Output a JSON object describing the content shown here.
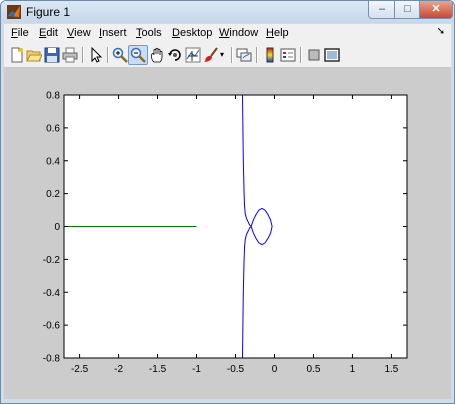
{
  "window": {
    "title": "Figure 1"
  },
  "captions": {
    "minimize": "–",
    "maximize": "□",
    "close": "✕"
  },
  "menu": [
    {
      "label": "File",
      "u": "F",
      "rest": "ile"
    },
    {
      "label": "Edit",
      "u": "E",
      "rest": "dit"
    },
    {
      "label": "View",
      "u": "V",
      "rest": "iew"
    },
    {
      "label": "Insert",
      "u": "I",
      "rest": "nsert"
    },
    {
      "label": "Tools",
      "u": "T",
      "rest": "ools"
    },
    {
      "label": "Desktop",
      "u": "D",
      "rest": "esktop"
    },
    {
      "label": "Window",
      "u": "W",
      "rest": "indow"
    },
    {
      "label": "Help",
      "u": "H",
      "rest": "elp"
    }
  ],
  "menu_extra_icon": "dock-arrow-icon",
  "toolbar": [
    "new-figure-icon",
    "open-file-icon",
    "save-icon",
    "print-icon",
    "edit-plot-icon",
    "zoom-in-icon",
    "zoom-out-icon",
    "pan-icon",
    "rotate-3d-icon",
    "data-cursor-icon",
    "brush-icon",
    "brush-dropdown-icon",
    "link-plot-icon",
    "insert-colorbar-icon",
    "insert-legend-icon",
    "hide-plot-tools-icon",
    "show-plot-tools-icon"
  ],
  "toolbar_active": "zoom-out-icon",
  "chart_data": {
    "type": "line",
    "title": "",
    "xlabel": "",
    "ylabel": "",
    "xlim": [
      -2.7,
      1.7
    ],
    "ylim": [
      -0.8,
      0.8
    ],
    "xticks": [
      -2.5,
      -2,
      -1.5,
      -1,
      -0.5,
      0,
      0.5,
      1,
      1.5
    ],
    "xtick_labels": [
      "-2.5",
      "-2",
      "-1.5",
      "-1",
      "-0.5",
      "0",
      "0.5",
      "1",
      "1.5"
    ],
    "yticks": [
      0.8,
      0.6,
      0.4,
      0.2,
      0,
      -0.2,
      -0.4,
      -0.6,
      -0.8
    ],
    "ytick_labels": [
      "0.8",
      "0.6",
      "0.4",
      "0.2",
      "0",
      "-0.2",
      "-0.4",
      "-0.6",
      "-0.8"
    ],
    "grid": false,
    "series": [
      {
        "color": "#008000",
        "x": [
          -2.7,
          -1.0
        ],
        "y": [
          0,
          0
        ]
      },
      {
        "color": "#0000ff",
        "x": [
          -0.41,
          -0.405,
          -0.4,
          -0.395,
          -0.39,
          -0.385,
          -0.375,
          -0.36,
          -0.34,
          -0.33,
          -0.32,
          -0.31,
          -0.3,
          -0.31,
          -0.32,
          -0.33,
          -0.34,
          -0.36,
          -0.375,
          -0.385,
          -0.39,
          -0.395,
          -0.4,
          -0.405,
          -0.41
        ],
        "y": [
          0.8,
          0.6,
          0.4,
          0.3,
          0.2,
          0.13,
          0.08,
          0.05,
          0.03,
          0.02,
          0.01,
          0.005,
          0,
          -0.005,
          -0.01,
          -0.02,
          -0.03,
          -0.05,
          -0.08,
          -0.13,
          -0.2,
          -0.3,
          -0.4,
          -0.6,
          -0.8
        ]
      },
      {
        "color": "#0000ff",
        "x": [
          -0.3,
          -0.27,
          -0.24,
          -0.2,
          -0.16,
          -0.12,
          -0.08,
          -0.05,
          -0.03,
          -0.05,
          -0.08,
          -0.12,
          -0.16,
          -0.2,
          -0.24,
          -0.27,
          -0.3
        ],
        "y": [
          0,
          0.04,
          0.07,
          0.1,
          0.11,
          0.1,
          0.07,
          0.04,
          0,
          -0.04,
          -0.07,
          -0.1,
          -0.11,
          -0.1,
          -0.07,
          -0.04,
          0
        ]
      }
    ]
  }
}
